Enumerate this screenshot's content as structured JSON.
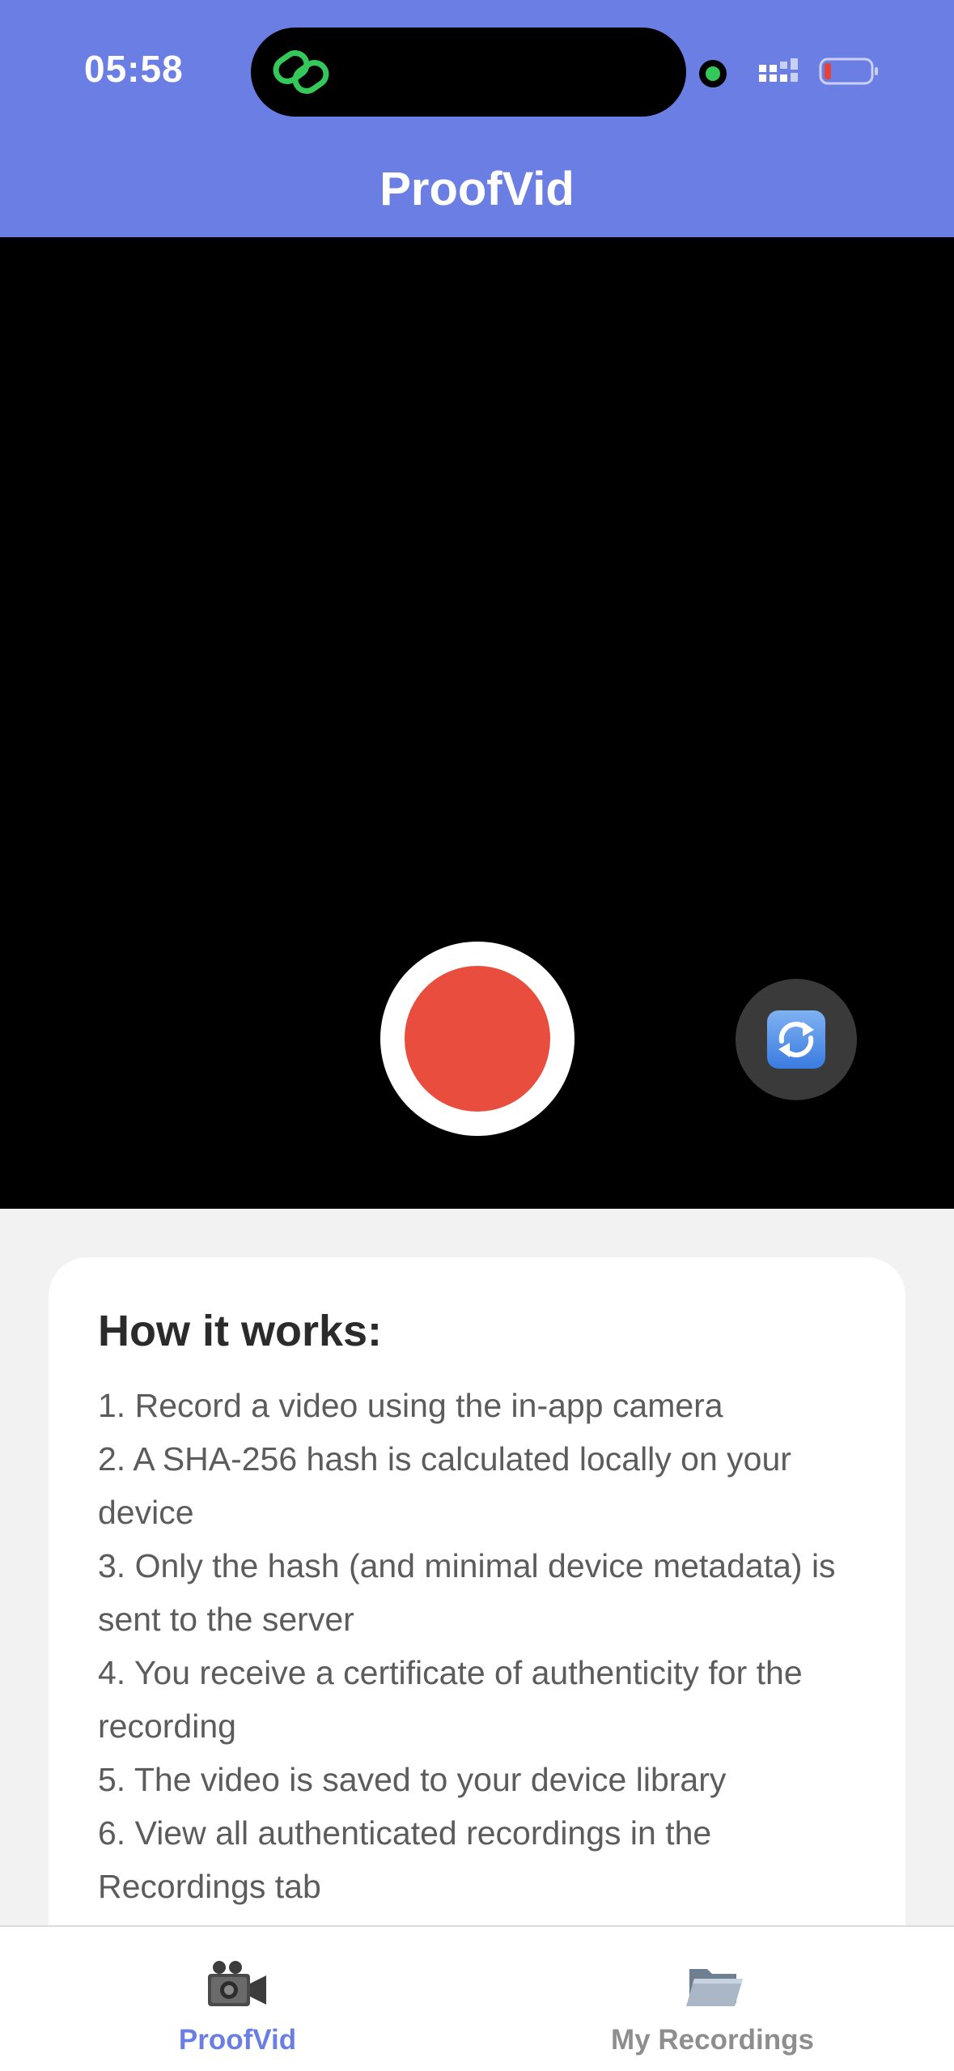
{
  "status_bar": {
    "time": "05:58"
  },
  "header": {
    "title": "ProofVid"
  },
  "camera": {
    "record_icon": "record-icon",
    "flip_icon": "camera-flip-icon"
  },
  "info_card": {
    "title": "How it works:",
    "steps": [
      "1. Record a video using the in-app camera",
      "2. A SHA-256 hash is calculated locally on your device",
      "3. Only the hash (and minimal device metadata) is sent to the server",
      "4. You receive a certificate of authenticity for the recording",
      "5. The video is saved to your device library",
      "6. View all authenticated recordings in the Recordings tab"
    ]
  },
  "tab_bar": {
    "tabs": [
      {
        "label": "ProofVid",
        "icon": "video-camera-icon",
        "active": true
      },
      {
        "label": "My Recordings",
        "icon": "folder-icon",
        "active": false
      }
    ]
  },
  "colors": {
    "accent": "#6b7ee3",
    "record": "#e84d3d",
    "camera_bg": "#000000",
    "inactive_tab": "#8e8e8e"
  }
}
